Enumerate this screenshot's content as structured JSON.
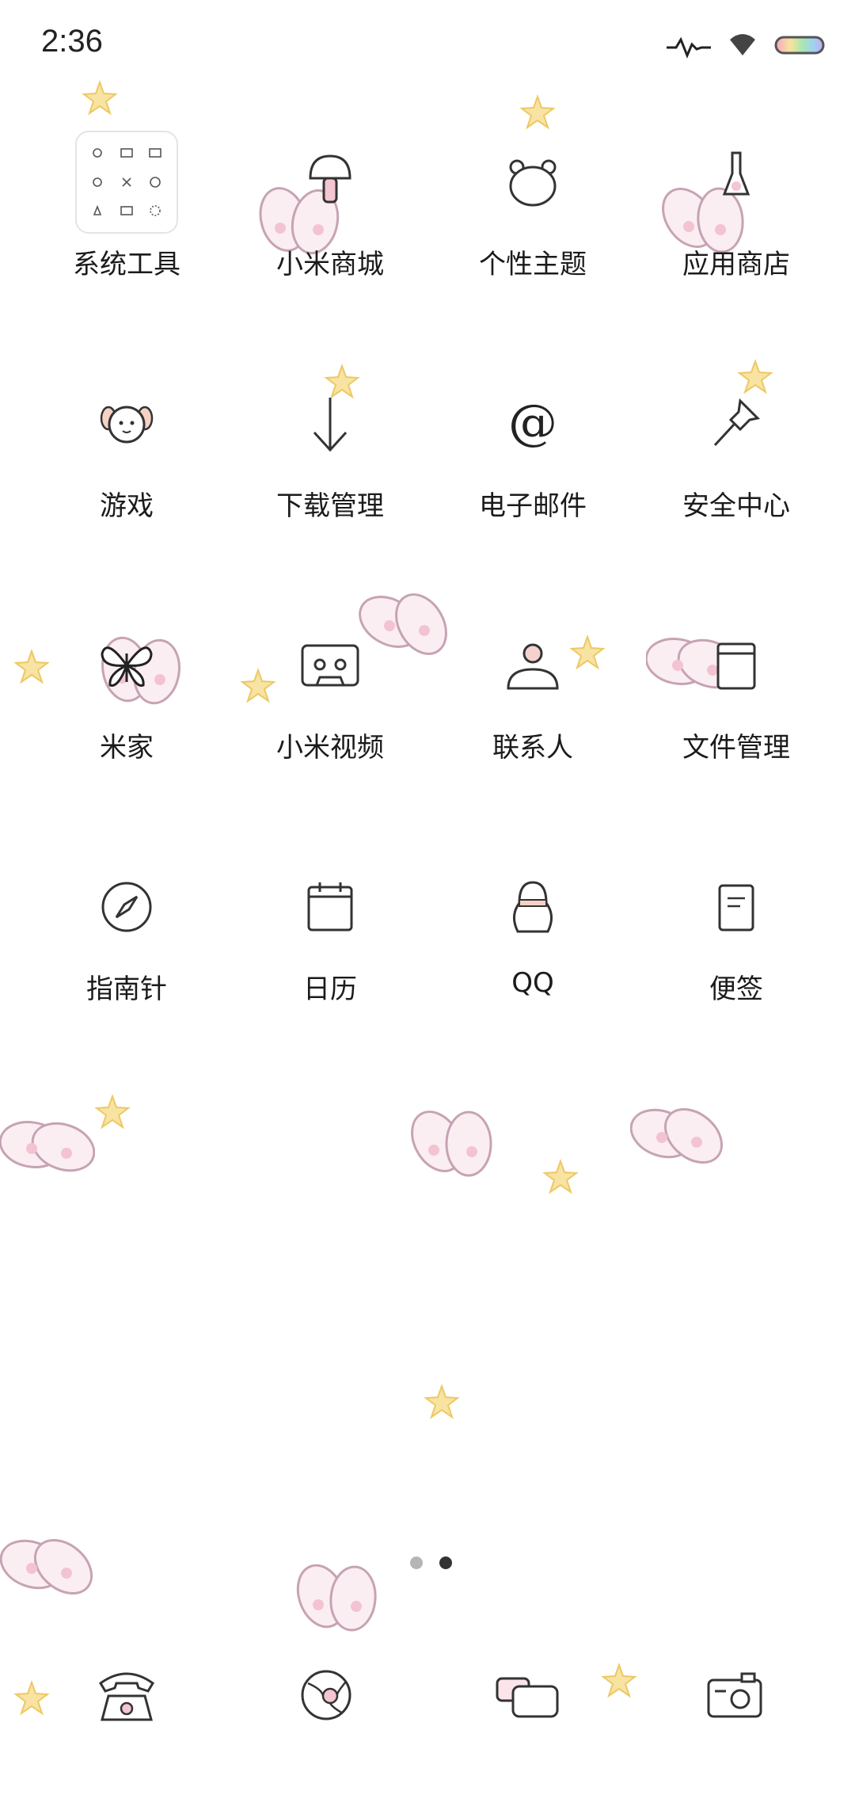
{
  "status_bar": {
    "time": "2:36",
    "icons": [
      "activity-icon",
      "wifi-icon",
      "battery-icon"
    ]
  },
  "apps": [
    {
      "label": "系统工具",
      "icon": "folder-system-tools-icon"
    },
    {
      "label": "小米商城",
      "icon": "mushroom-store-icon"
    },
    {
      "label": "个性主题",
      "icon": "bear-face-theme-icon"
    },
    {
      "label": "应用商店",
      "icon": "rabbit-app-store-icon"
    },
    {
      "label": "游戏",
      "icon": "puppy-game-icon"
    },
    {
      "label": "下载管理",
      "icon": "down-arrow-download-icon"
    },
    {
      "label": "电子邮件",
      "icon": "at-sign-email-icon"
    },
    {
      "label": "安全中心",
      "icon": "pushpin-security-icon"
    },
    {
      "label": "米家",
      "icon": "butterfly-mijia-icon"
    },
    {
      "label": "小米视频",
      "icon": "cassette-video-icon"
    },
    {
      "label": "联系人",
      "icon": "person-contacts-icon"
    },
    {
      "label": "文件管理",
      "icon": "folder-file-manager-icon"
    },
    {
      "label": "指南针",
      "icon": "compass-icon"
    },
    {
      "label": "日历",
      "icon": "calendar-icon"
    },
    {
      "label": "QQ",
      "icon": "penguin-qq-icon"
    },
    {
      "label": "便签",
      "icon": "notepad-icon"
    }
  ],
  "page_indicator": {
    "pages": 2,
    "current": 2
  },
  "dock": [
    {
      "icon": "phone-icon"
    },
    {
      "icon": "browser-icon"
    },
    {
      "icon": "messages-icon"
    },
    {
      "icon": "camera-icon"
    }
  ],
  "colors": {
    "text": "#1b1b1b",
    "icon_stroke": "#333333",
    "bunny_pink": "#f3c9d6",
    "star_yellow": "#f6dc8e",
    "dot_inactive": "#b5b5b5",
    "dot_active": "#333333"
  }
}
